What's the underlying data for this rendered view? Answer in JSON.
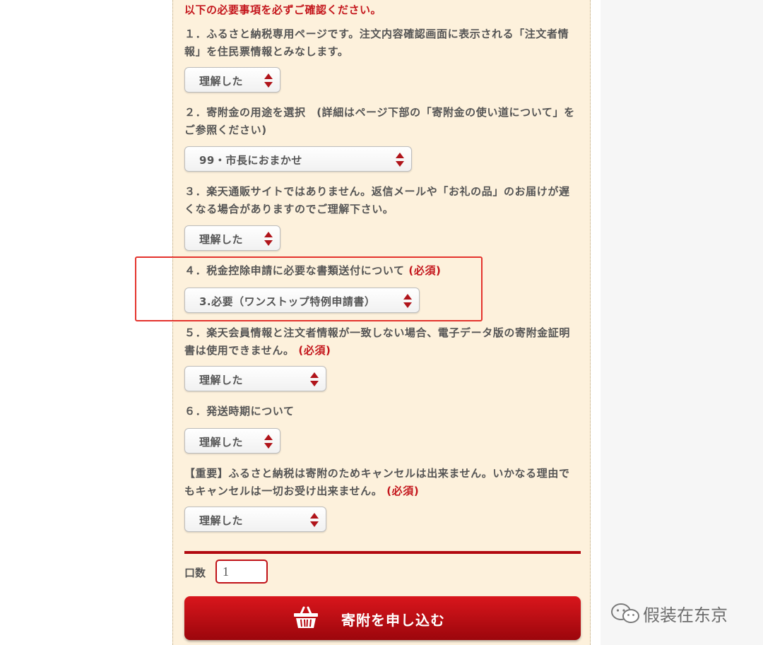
{
  "notice": "以下の必要事項を必ずご確認ください。",
  "required_mark": "(必須)",
  "items": [
    {
      "text": "１．ふるさと納税専用ページです。注文内容確認画面に表示される「注文者情報」を住民票情報とみなします。",
      "selected": "理解した"
    },
    {
      "text": "２．寄附金の用途を選択　(詳細はページ下部の「寄附金の使い道について」をご参照ください)",
      "selected": "99・市長におまかせ"
    },
    {
      "text": "３．楽天通販サイトではありません。返信メールや「お礼の品」のお届けが遅くなる場合がありますのでご理解下さい。",
      "selected": "理解した"
    },
    {
      "text": "４．税金控除申請に必要な書類送付について",
      "selected": "3.必要（ワンストップ特例申請書）"
    },
    {
      "text": "５．楽天会員情報と注文者情報が一致しない場合、電子データ版の寄附金証明書は使用できません。",
      "selected": "理解した"
    },
    {
      "text": "６．発送時期について",
      "selected": "理解した"
    },
    {
      "text": "【重要】ふるさと納税は寄附のためキャンセルは出来ません。いかなる理由でもキャンセルは一切お受け出来ません。",
      "selected": "理解した"
    }
  ],
  "quantity": {
    "label": "口数",
    "value": "1"
  },
  "submit_label": "寄附を申し込む",
  "watermark": "假装在东京",
  "icons": {
    "submit": "basket-icon",
    "watermark": "wechat-icon",
    "select": "select-arrows-icon"
  },
  "colors": {
    "accent": "#c4161c",
    "panel": "#fdf1dc",
    "button": "#c0101a",
    "text": "#555555"
  }
}
